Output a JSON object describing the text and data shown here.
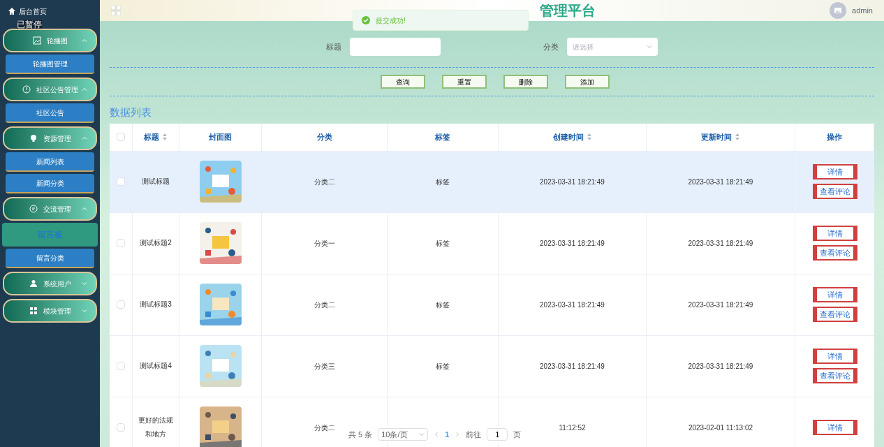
{
  "paused_label": "已暂停",
  "sidebar": {
    "home": "后台首页",
    "groups": [
      {
        "label": "轮播图",
        "expanded": true,
        "children": [
          {
            "label": "轮播图管理",
            "selected": false
          }
        ]
      },
      {
        "label": "社区公告管理",
        "expanded": true,
        "children": [
          {
            "label": "社区公告",
            "selected": false
          }
        ]
      },
      {
        "label": "资源管理",
        "expanded": true,
        "children": [
          {
            "label": "新闻列表",
            "selected": false
          },
          {
            "label": "新闻分类",
            "selected": false
          }
        ]
      },
      {
        "label": "交流管理",
        "expanded": true,
        "children": [
          {
            "label": "留言板",
            "selected": true
          },
          {
            "label": "留言分类",
            "selected": false
          }
        ]
      },
      {
        "label": "系统用户",
        "expanded": false
      },
      {
        "label": "模块管理",
        "expanded": false
      }
    ]
  },
  "header": {
    "title": "管理平台",
    "user": "admin"
  },
  "toast": {
    "message": "提交成功!"
  },
  "search": {
    "fields": [
      {
        "label": "标题",
        "kind": "text"
      },
      {
        "label": "分类",
        "kind": "select",
        "placeholder": "请选择"
      }
    ],
    "buttons": [
      "查询",
      "重置",
      "删除",
      "添加"
    ]
  },
  "section_title": "数据列表",
  "table": {
    "columns": [
      {
        "label": "标题",
        "kind": "sortable"
      },
      {
        "label": "封面图",
        "kind": "plain"
      },
      {
        "label": "分类",
        "kind": "plain"
      },
      {
        "label": "标签",
        "kind": "plain"
      },
      {
        "label": "创建时间",
        "kind": "sortable"
      },
      {
        "label": "更新时间",
        "kind": "sortable"
      },
      {
        "label": "操作",
        "kind": "plain"
      }
    ],
    "header_checked": false,
    "rows": [
      {
        "checked": false,
        "highlighted": true,
        "title": "测试标题",
        "category": "分类二",
        "tag": "标签",
        "created": "2023-03-31 18:21:49",
        "updated": "2023-03-31 18:21:49",
        "actions": [
          "详情",
          "查看评论"
        ]
      },
      {
        "checked": false,
        "highlighted": false,
        "title": "测试标题2",
        "category": "分类一",
        "tag": "标签",
        "created": "2023-03-31 18:21:49",
        "updated": "2023-03-31 18:21:49",
        "actions": [
          "详情",
          "查看评论"
        ]
      },
      {
        "checked": false,
        "highlighted": false,
        "title": "测试标题3",
        "category": "分类二",
        "tag": "标签",
        "created": "2023-03-31 18:21:49",
        "updated": "2023-03-31 18:21:49",
        "actions": [
          "详情",
          "查看评论"
        ]
      },
      {
        "checked": false,
        "highlighted": false,
        "title": "测试标题4",
        "category": "分类三",
        "tag": "标签",
        "created": "2023-03-31 18:21:49",
        "updated": "2023-03-31 18:21:49",
        "actions": [
          "详情",
          "查看评论"
        ]
      },
      {
        "checked": false,
        "highlighted": false,
        "title": "更好的法规和地方",
        "category": "分类二",
        "created": "11:12:52",
        "updated": "2023-02-01 11:13:02",
        "actions": [
          "详情"
        ]
      }
    ]
  },
  "pagination": {
    "total": "共 5 条",
    "page_size": "10条/页",
    "pages": [
      {
        "label": "1",
        "selected": true
      }
    ],
    "goto_label": "前往",
    "goto_value": "1",
    "goto_suffix": "页"
  }
}
